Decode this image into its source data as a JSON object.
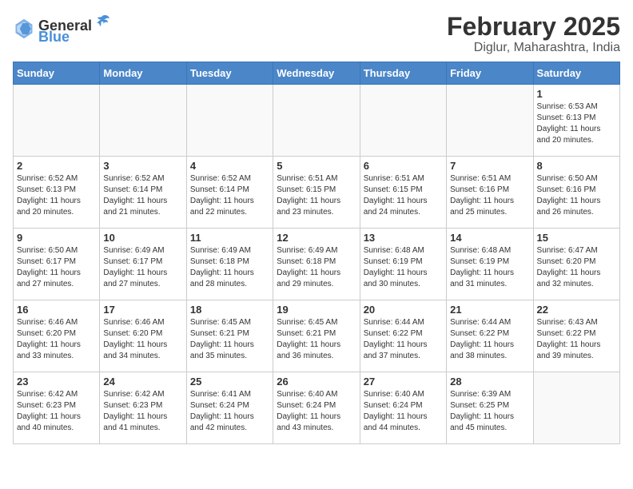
{
  "logo": {
    "general": "General",
    "blue": "Blue"
  },
  "title": "February 2025",
  "subtitle": "Diglur, Maharashtra, India",
  "weekdays": [
    "Sunday",
    "Monday",
    "Tuesday",
    "Wednesday",
    "Thursday",
    "Friday",
    "Saturday"
  ],
  "weeks": [
    [
      {
        "day": "",
        "info": ""
      },
      {
        "day": "",
        "info": ""
      },
      {
        "day": "",
        "info": ""
      },
      {
        "day": "",
        "info": ""
      },
      {
        "day": "",
        "info": ""
      },
      {
        "day": "",
        "info": ""
      },
      {
        "day": "1",
        "info": "Sunrise: 6:53 AM\nSunset: 6:13 PM\nDaylight: 11 hours\nand 20 minutes."
      }
    ],
    [
      {
        "day": "2",
        "info": "Sunrise: 6:52 AM\nSunset: 6:13 PM\nDaylight: 11 hours\nand 20 minutes."
      },
      {
        "day": "3",
        "info": "Sunrise: 6:52 AM\nSunset: 6:14 PM\nDaylight: 11 hours\nand 21 minutes."
      },
      {
        "day": "4",
        "info": "Sunrise: 6:52 AM\nSunset: 6:14 PM\nDaylight: 11 hours\nand 22 minutes."
      },
      {
        "day": "5",
        "info": "Sunrise: 6:51 AM\nSunset: 6:15 PM\nDaylight: 11 hours\nand 23 minutes."
      },
      {
        "day": "6",
        "info": "Sunrise: 6:51 AM\nSunset: 6:15 PM\nDaylight: 11 hours\nand 24 minutes."
      },
      {
        "day": "7",
        "info": "Sunrise: 6:51 AM\nSunset: 6:16 PM\nDaylight: 11 hours\nand 25 minutes."
      },
      {
        "day": "8",
        "info": "Sunrise: 6:50 AM\nSunset: 6:16 PM\nDaylight: 11 hours\nand 26 minutes."
      }
    ],
    [
      {
        "day": "9",
        "info": "Sunrise: 6:50 AM\nSunset: 6:17 PM\nDaylight: 11 hours\nand 27 minutes."
      },
      {
        "day": "10",
        "info": "Sunrise: 6:49 AM\nSunset: 6:17 PM\nDaylight: 11 hours\nand 27 minutes."
      },
      {
        "day": "11",
        "info": "Sunrise: 6:49 AM\nSunset: 6:18 PM\nDaylight: 11 hours\nand 28 minutes."
      },
      {
        "day": "12",
        "info": "Sunrise: 6:49 AM\nSunset: 6:18 PM\nDaylight: 11 hours\nand 29 minutes."
      },
      {
        "day": "13",
        "info": "Sunrise: 6:48 AM\nSunset: 6:19 PM\nDaylight: 11 hours\nand 30 minutes."
      },
      {
        "day": "14",
        "info": "Sunrise: 6:48 AM\nSunset: 6:19 PM\nDaylight: 11 hours\nand 31 minutes."
      },
      {
        "day": "15",
        "info": "Sunrise: 6:47 AM\nSunset: 6:20 PM\nDaylight: 11 hours\nand 32 minutes."
      }
    ],
    [
      {
        "day": "16",
        "info": "Sunrise: 6:46 AM\nSunset: 6:20 PM\nDaylight: 11 hours\nand 33 minutes."
      },
      {
        "day": "17",
        "info": "Sunrise: 6:46 AM\nSunset: 6:20 PM\nDaylight: 11 hours\nand 34 minutes."
      },
      {
        "day": "18",
        "info": "Sunrise: 6:45 AM\nSunset: 6:21 PM\nDaylight: 11 hours\nand 35 minutes."
      },
      {
        "day": "19",
        "info": "Sunrise: 6:45 AM\nSunset: 6:21 PM\nDaylight: 11 hours\nand 36 minutes."
      },
      {
        "day": "20",
        "info": "Sunrise: 6:44 AM\nSunset: 6:22 PM\nDaylight: 11 hours\nand 37 minutes."
      },
      {
        "day": "21",
        "info": "Sunrise: 6:44 AM\nSunset: 6:22 PM\nDaylight: 11 hours\nand 38 minutes."
      },
      {
        "day": "22",
        "info": "Sunrise: 6:43 AM\nSunset: 6:22 PM\nDaylight: 11 hours\nand 39 minutes."
      }
    ],
    [
      {
        "day": "23",
        "info": "Sunrise: 6:42 AM\nSunset: 6:23 PM\nDaylight: 11 hours\nand 40 minutes."
      },
      {
        "day": "24",
        "info": "Sunrise: 6:42 AM\nSunset: 6:23 PM\nDaylight: 11 hours\nand 41 minutes."
      },
      {
        "day": "25",
        "info": "Sunrise: 6:41 AM\nSunset: 6:24 PM\nDaylight: 11 hours\nand 42 minutes."
      },
      {
        "day": "26",
        "info": "Sunrise: 6:40 AM\nSunset: 6:24 PM\nDaylight: 11 hours\nand 43 minutes."
      },
      {
        "day": "27",
        "info": "Sunrise: 6:40 AM\nSunset: 6:24 PM\nDaylight: 11 hours\nand 44 minutes."
      },
      {
        "day": "28",
        "info": "Sunrise: 6:39 AM\nSunset: 6:25 PM\nDaylight: 11 hours\nand 45 minutes."
      },
      {
        "day": "",
        "info": ""
      }
    ]
  ]
}
